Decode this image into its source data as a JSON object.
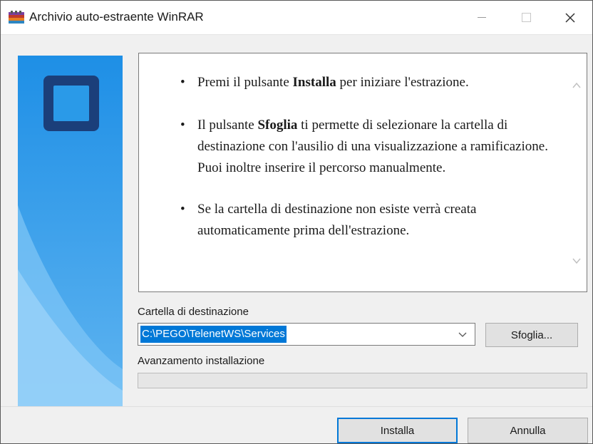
{
  "window": {
    "title": "Archivio auto-estraente WinRAR",
    "icons": [
      "winrar-icon",
      "minimize-icon",
      "maximize-icon",
      "close-icon"
    ]
  },
  "info": {
    "items": [
      {
        "before": "Premi il pulsante ",
        "bold": "Installa",
        "after": " per iniziare l'estrazione."
      },
      {
        "before": "Il pulsante ",
        "bold": "Sfoglia",
        "after": " ti permette di selezionare la cartella di destinazione con l'ausilio di una visualizzazione a ramificazione. Puoi inoltre inserire il percorso manualmente."
      },
      {
        "before": "Se la cartella di destinazione non esiste verrà creata automaticamente prima dell'estrazione.",
        "bold": "",
        "after": ""
      }
    ]
  },
  "destination": {
    "label": "Cartella di destinazione",
    "value": "C:\\PEGO\\TelenetWS\\Services",
    "browse_label": "Sfoglia..."
  },
  "progress": {
    "label": "Avanzamento installazione",
    "value": 0
  },
  "footer": {
    "install_label": "Installa",
    "cancel_label": "Annulla"
  },
  "colors": {
    "accent": "#0078d7",
    "banner_top": "#1e8fe6",
    "banner_bottom": "#7cc4f5",
    "banner_logo": "#1b3f7a"
  }
}
